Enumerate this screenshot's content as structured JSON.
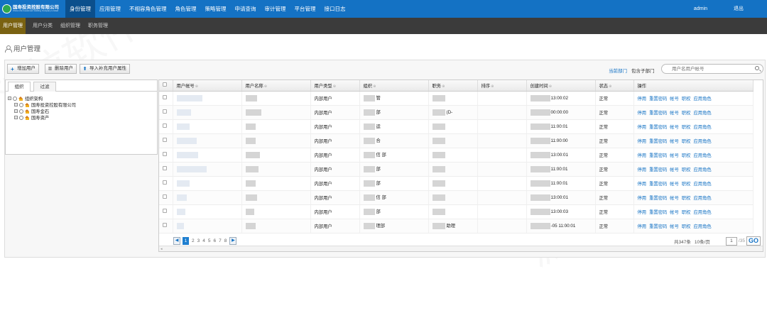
{
  "logo": {
    "cn": "国寿投资控股有限公司",
    "en": "China Life Investment Holding Company Limited"
  },
  "nav": {
    "items": [
      "身份管理",
      "应用管理",
      "不相容角色管理",
      "角色管理",
      "策略管理",
      "申请查询",
      "审计管理",
      "平台管理",
      "接口日志"
    ],
    "active_index": 0,
    "user": "admin",
    "logout": "退出"
  },
  "subnav": {
    "items": [
      "用户管理",
      "用户分类",
      "组织管理",
      "职务管理"
    ],
    "active_index": 0
  },
  "page_title": "用户管理",
  "toolbar": {
    "add": "增加用户",
    "delete": "删除用户",
    "import": "导入补充用户属性",
    "current_dept": "当前部门",
    "include_sub": "包含子部门",
    "search_placeholder": "用户名用户帐号"
  },
  "tree": {
    "tabs": [
      "组织",
      "过滤"
    ],
    "nodes": [
      {
        "label": "组织架构",
        "level": 0
      },
      {
        "label": "国寿投资控股有限公司",
        "level": 1
      },
      {
        "label": "国寿金石",
        "level": 1
      },
      {
        "label": "国寿资产",
        "level": 1
      }
    ]
  },
  "table": {
    "columns": [
      "用户帐号",
      "用户名称",
      "用户类型",
      "组织",
      "职务",
      "排序",
      "创建时间",
      "状态",
      "操作"
    ],
    "actions": [
      "停用",
      "重置密码",
      "帐号",
      "职权",
      "应用角色"
    ],
    "rows": [
      {
        "type": "内部用户",
        "org": "管",
        "post": "",
        "time": "13:00:02",
        "status": "正常"
      },
      {
        "type": "内部用户",
        "org": "部",
        "post": "(D-",
        "time": "00:00:00",
        "status": "正常"
      },
      {
        "type": "内部用户",
        "org": "运",
        "post": "",
        "time": "11:00:01",
        "status": "正常"
      },
      {
        "type": "内部用户",
        "org": "合",
        "post": "",
        "time": "11:00:00",
        "status": "正常"
      },
      {
        "type": "内部用户",
        "org": "信 部",
        "post": "",
        "time": "13:00:01",
        "status": "正常"
      },
      {
        "type": "内部用户",
        "org": "部",
        "post": "",
        "time": "11:00:01",
        "status": "正常"
      },
      {
        "type": "内部用户",
        "org": "部",
        "post": "",
        "time": "11:00:01",
        "status": "正常"
      },
      {
        "type": "内部用户",
        "org": "信 部",
        "post": "",
        "time": "13:00:01",
        "status": "正常"
      },
      {
        "type": "内部用户",
        "org": "部",
        "post": "",
        "time": "13:00:03",
        "status": "正常"
      },
      {
        "type": "内部用户",
        "org": "理部",
        "post": "助理",
        "time": "-05 11:00:01",
        "status": "正常"
      }
    ]
  },
  "pager": {
    "pages": [
      "1",
      "2",
      "3",
      "4",
      "5",
      "6",
      "7",
      "8"
    ],
    "current": "1",
    "total": "共347条",
    "per_page": "10条/页",
    "page_input": "1",
    "page_total": "/35",
    "go": "GO"
  },
  "watermark": "派拉软件"
}
